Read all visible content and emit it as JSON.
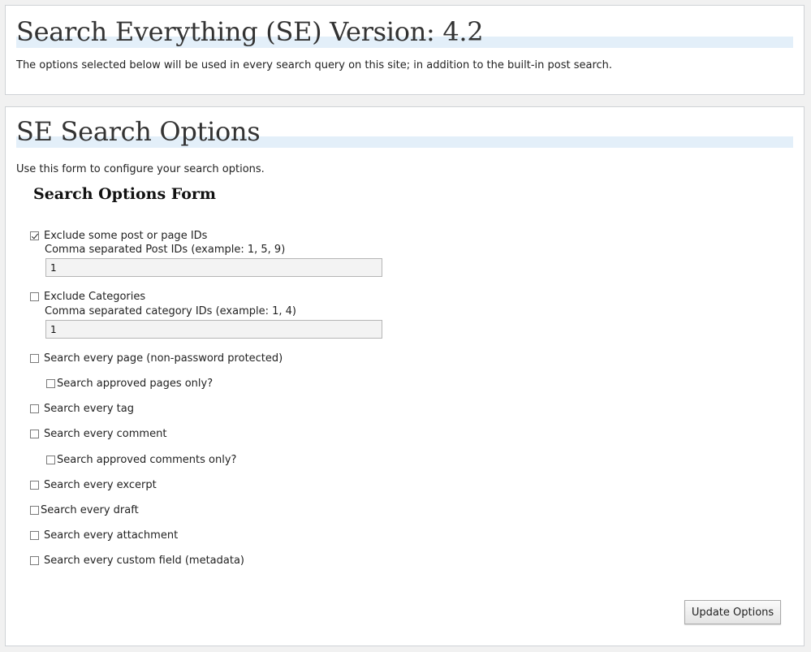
{
  "header_panel": {
    "title": "Search Everything (SE) Version: 4.2",
    "description": "The options selected below will be used in every search query on this site; in addition to the built-in post search."
  },
  "options_panel": {
    "title": "SE Search Options",
    "description": "Use this form to configure your search options.",
    "form_title": "Search Options Form",
    "exclude_posts": {
      "label": "Exclude some post or page IDs",
      "checked": true,
      "sublabel": "Comma separated Post IDs (example: 1, 5, 9)",
      "value": "1"
    },
    "exclude_categories": {
      "label": "Exclude Categories",
      "checked": false,
      "sublabel": "Comma separated category IDs (example: 1, 4)",
      "value": "1"
    },
    "options": [
      {
        "label": "Search every page (non-password protected)",
        "checked": false
      },
      {
        "label": "Search approved pages only?",
        "checked": false
      },
      {
        "label": "Search every tag",
        "checked": false
      },
      {
        "label": "Search every comment",
        "checked": false
      },
      {
        "label": "Search approved comments only?",
        "checked": false
      },
      {
        "label": "Search every excerpt",
        "checked": false
      },
      {
        "label": "Search every draft",
        "checked": false
      },
      {
        "label": "Search every attachment",
        "checked": false
      },
      {
        "label": "Search every custom field (metadata)",
        "checked": false
      }
    ],
    "submit_label": "Update Options"
  }
}
